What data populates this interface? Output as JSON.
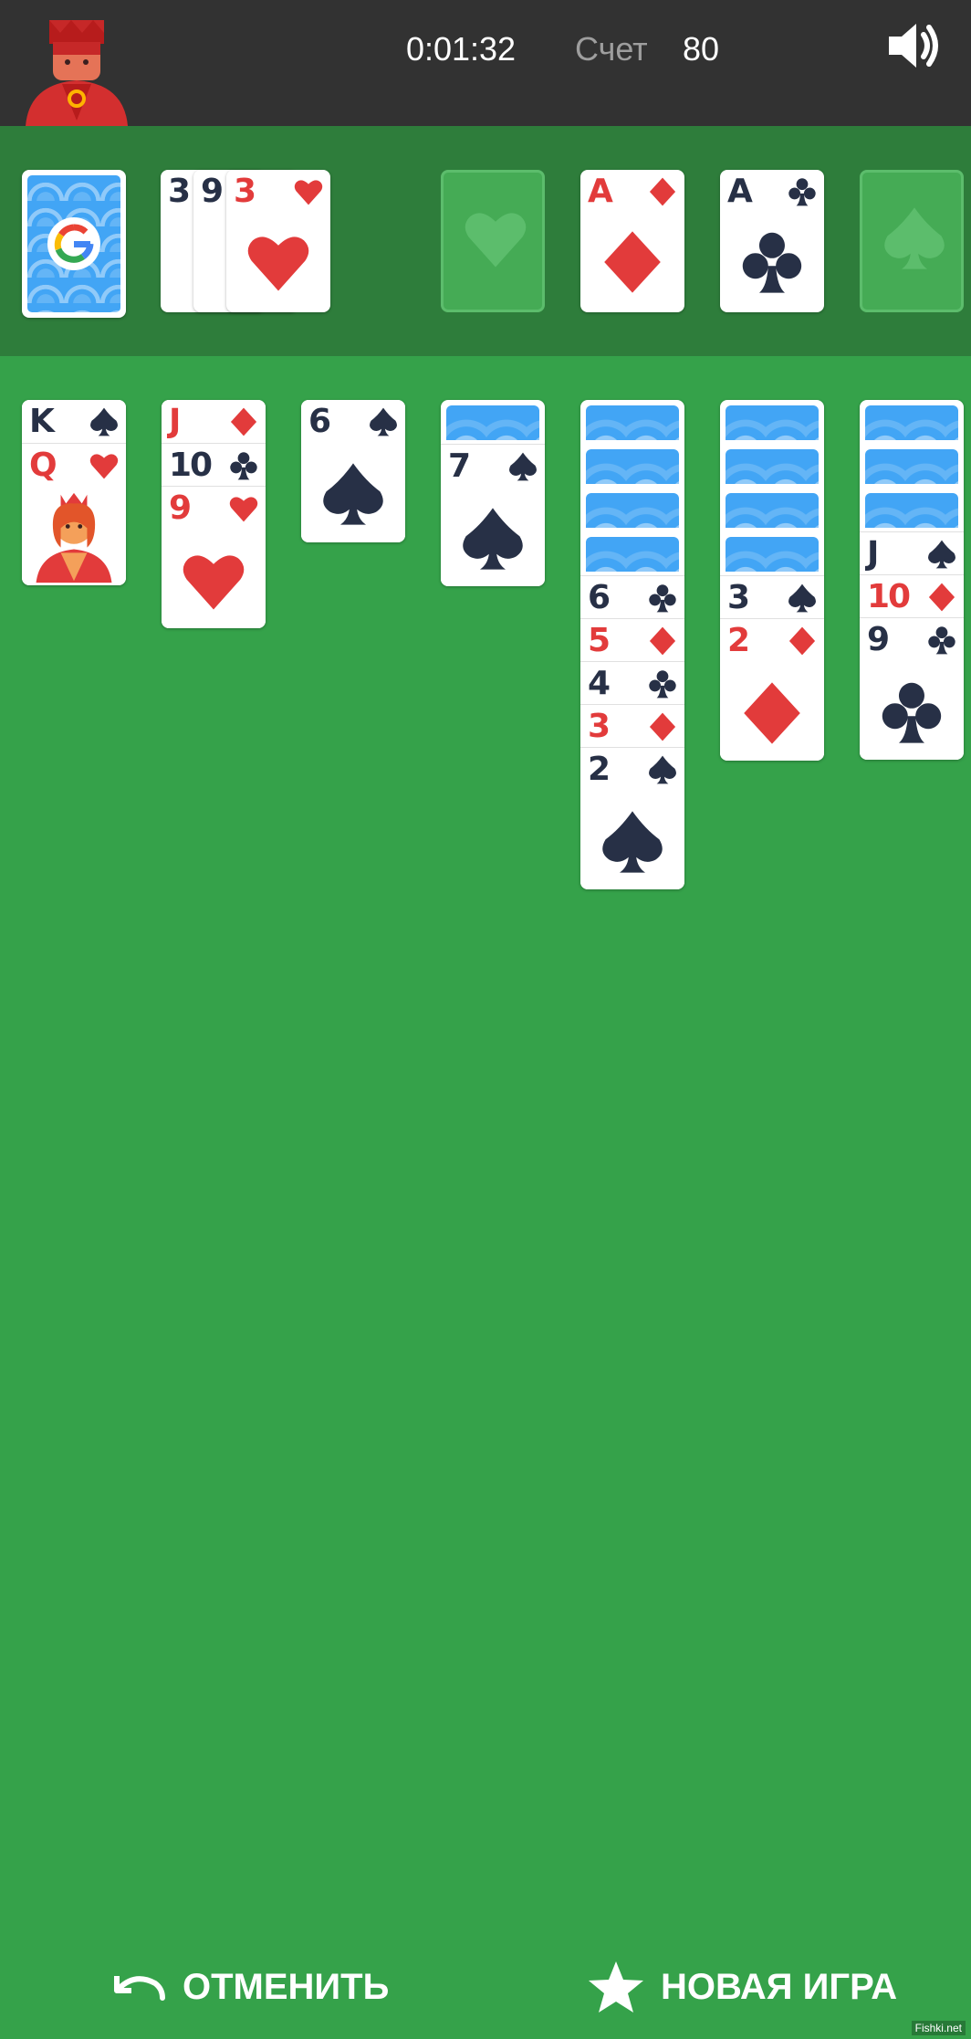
{
  "header": {
    "timer": "0:01:32",
    "score_label": "Счет",
    "score_value": "80"
  },
  "colors": {
    "felt": "#35a24a",
    "top_row": "#2e7d3b",
    "header_bg": "#323232",
    "red_suit": "#e23b3b",
    "black_suit": "#273046",
    "card_back": "#42a5f5"
  },
  "icons": {
    "avatar": "king-avatar-icon",
    "sound": "speaker-icon",
    "undo": "undo-arrow-icon",
    "new_game": "star-icon",
    "stock_logo": "google-g-logo"
  },
  "stock": {
    "face_down": true
  },
  "waste": [
    {
      "rank": "3",
      "suit": "spades"
    },
    {
      "rank": "9",
      "suit": "spades"
    },
    {
      "rank": "3",
      "suit": "hearts"
    }
  ],
  "foundations": [
    {
      "suit": "hearts",
      "empty": true
    },
    {
      "rank": "A",
      "suit": "diamonds"
    },
    {
      "rank": "A",
      "suit": "clubs"
    },
    {
      "suit": "spades",
      "empty": true
    }
  ],
  "tableau": [
    {
      "face_down": 0,
      "face_up": [
        {
          "rank": "K",
          "suit": "spades"
        },
        {
          "rank": "Q",
          "suit": "hearts"
        }
      ]
    },
    {
      "face_down": 0,
      "face_up": [
        {
          "rank": "J",
          "suit": "diamonds"
        },
        {
          "rank": "10",
          "suit": "clubs"
        },
        {
          "rank": "9",
          "suit": "hearts"
        }
      ]
    },
    {
      "face_down": 0,
      "face_up": [
        {
          "rank": "6",
          "suit": "spades"
        }
      ]
    },
    {
      "face_down": 1,
      "face_up": [
        {
          "rank": "7",
          "suit": "spades"
        }
      ]
    },
    {
      "face_down": 4,
      "face_up": [
        {
          "rank": "6",
          "suit": "clubs"
        },
        {
          "rank": "5",
          "suit": "diamonds"
        },
        {
          "rank": "4",
          "suit": "clubs"
        },
        {
          "rank": "3",
          "suit": "diamonds"
        },
        {
          "rank": "2",
          "suit": "spades"
        }
      ]
    },
    {
      "face_down": 4,
      "face_up": [
        {
          "rank": "3",
          "suit": "spades"
        },
        {
          "rank": "2",
          "suit": "diamonds"
        }
      ]
    },
    {
      "face_down": 3,
      "face_up": [
        {
          "rank": "J",
          "suit": "spades"
        },
        {
          "rank": "10",
          "suit": "diamonds"
        },
        {
          "rank": "9",
          "suit": "clubs"
        }
      ]
    }
  ],
  "actions": {
    "undo_label": "ОТМЕНИТЬ",
    "new_game_label": "НОВАЯ ИГРА"
  },
  "watermark": "Fishki.net"
}
